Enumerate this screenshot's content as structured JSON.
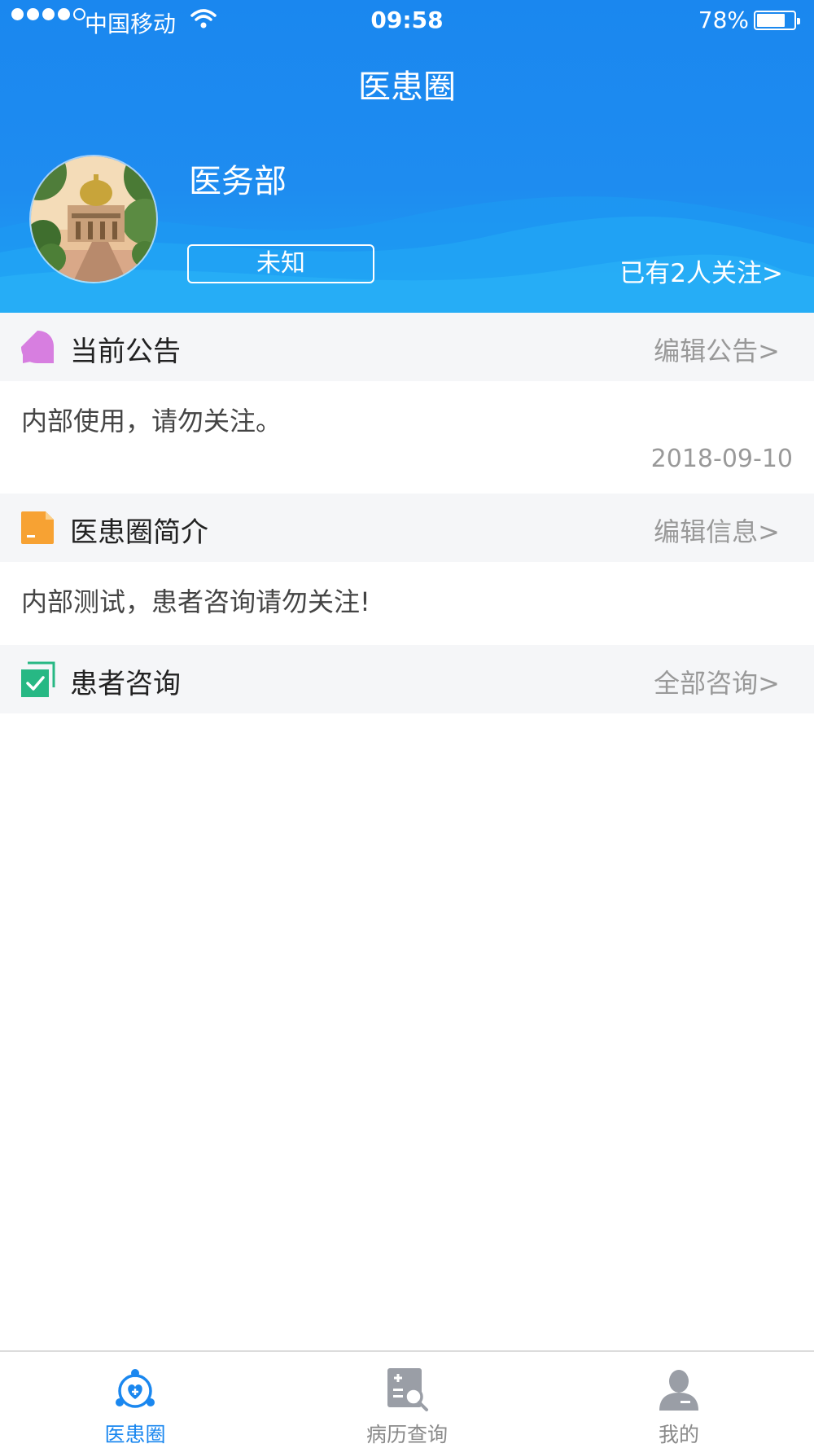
{
  "status_bar": {
    "carrier": "中国移动",
    "time": "09:58",
    "battery": "78%"
  },
  "nav": {
    "title": "医患圈"
  },
  "profile": {
    "name": "医务部",
    "status": "未知",
    "followers": "已有2人关注>"
  },
  "announcement": {
    "title": "当前公告",
    "action": "编辑公告>",
    "text": "内部使用，请勿关注。",
    "date": "2018-09-10"
  },
  "intro": {
    "title": "医患圈简介",
    "action": "编辑信息>",
    "text": "内部测试，患者咨询请勿关注!"
  },
  "consult": {
    "title": "患者咨询",
    "action": "全部咨询>"
  },
  "tabs": [
    {
      "label": "医患圈",
      "icon": "circle-heart-icon",
      "active": true
    },
    {
      "label": "病历查询",
      "icon": "record-search-icon",
      "active": false
    },
    {
      "label": "我的",
      "icon": "user-icon",
      "active": false
    }
  ],
  "colors": {
    "primary": "#1a87ef",
    "announcement_icon": "#d77ee0",
    "intro_icon": "#f7a233",
    "consult_icon": "#27b884"
  }
}
